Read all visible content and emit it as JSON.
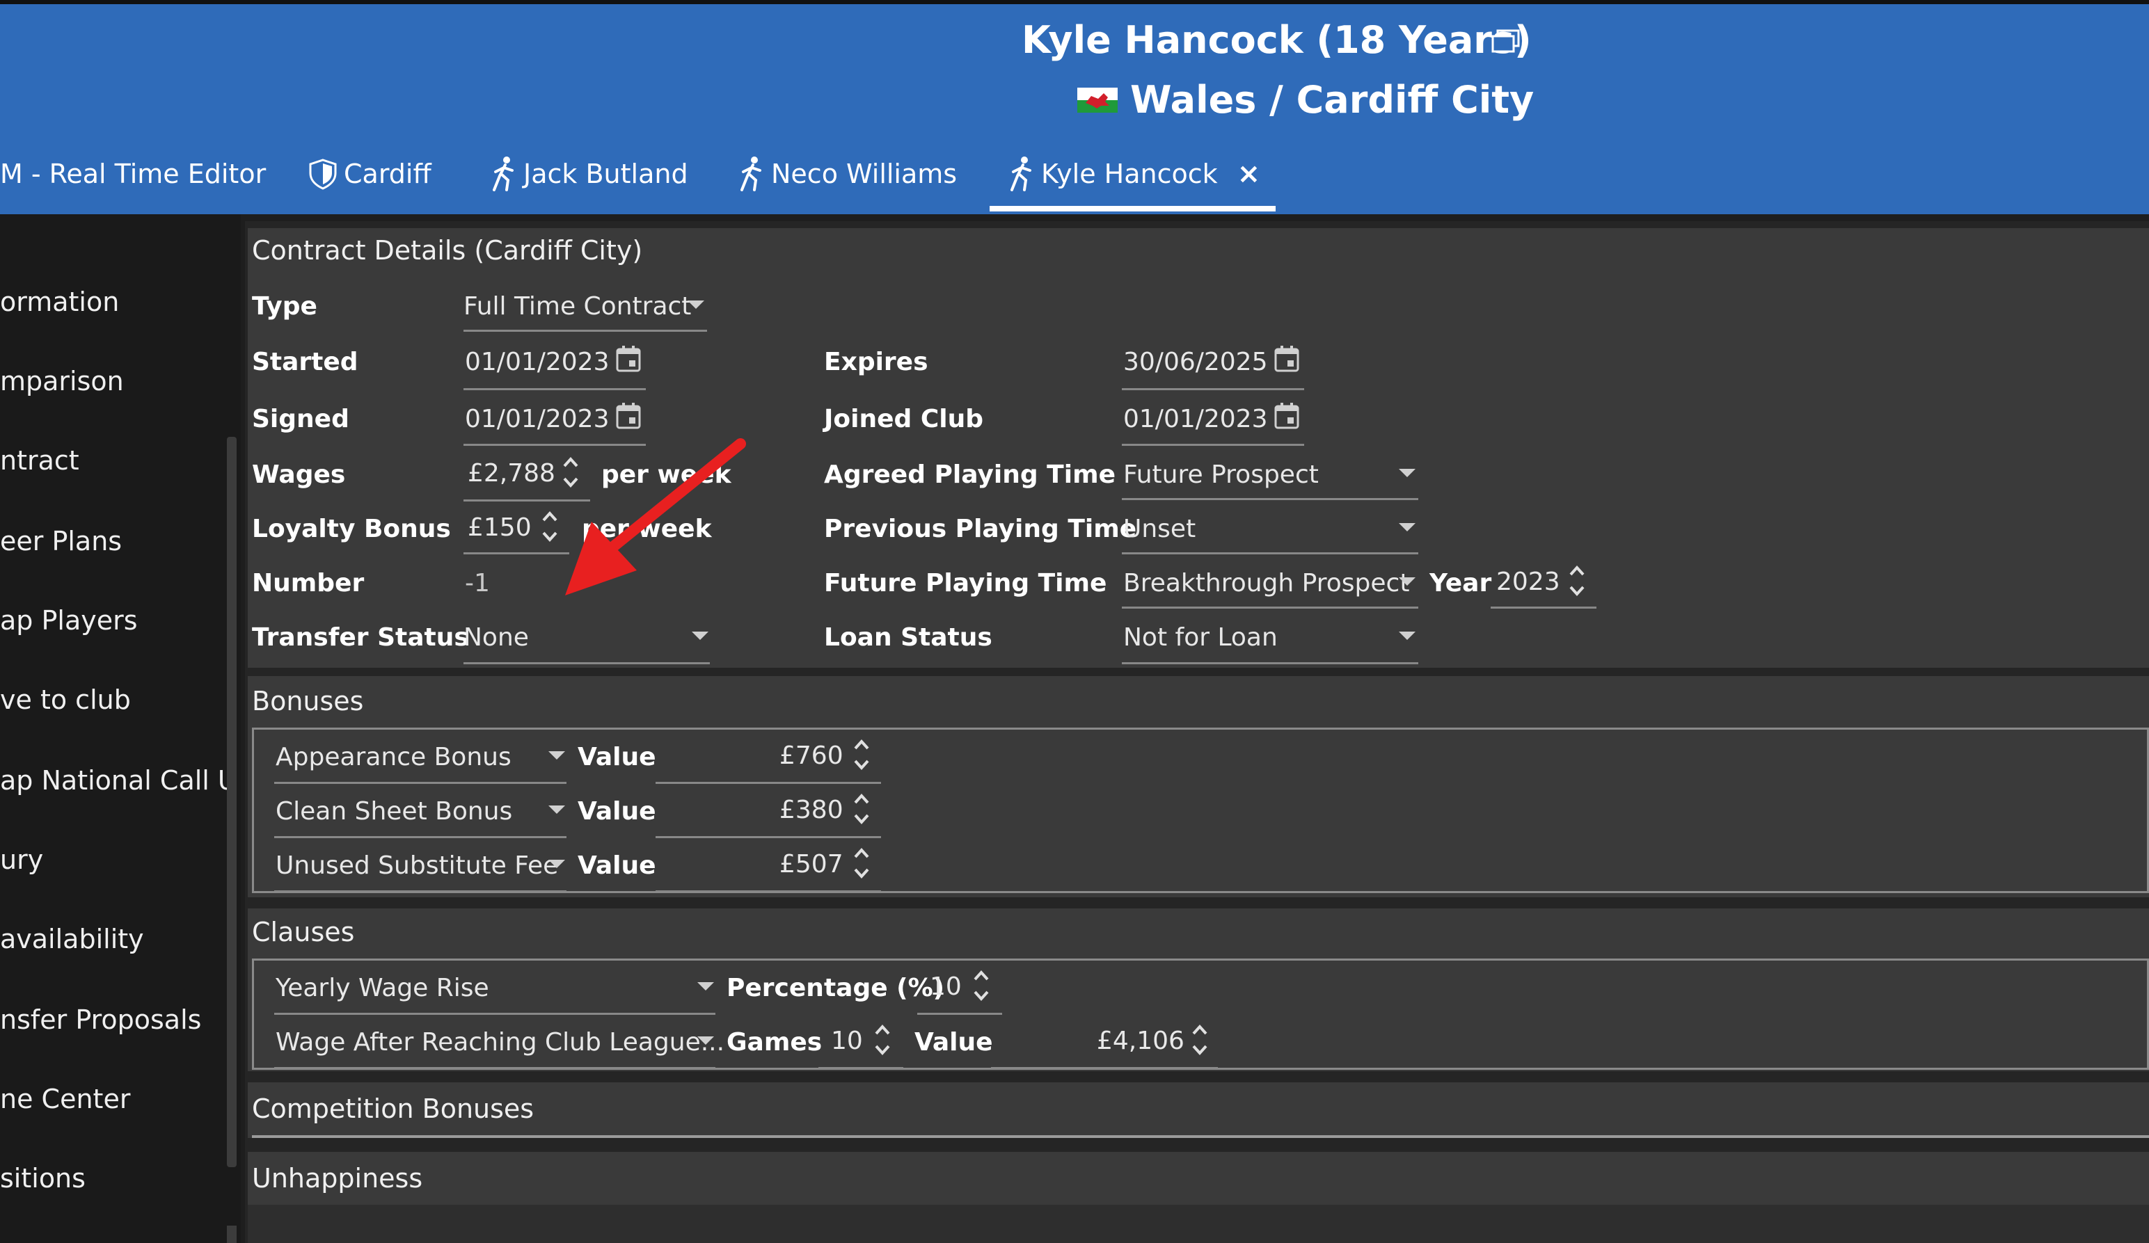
{
  "header": {
    "title": "Kyle Hancock (18 Years)",
    "subtitle": "Wales / Cardiff City",
    "colors": {
      "bar": "#2f6bb9",
      "text": "#ffffff"
    }
  },
  "tabs": [
    {
      "label": "M - Real Time Editor",
      "icon": "none"
    },
    {
      "label": "Cardiff",
      "icon": "shield-icon"
    },
    {
      "label": "Jack Butland",
      "icon": "running-player-icon"
    },
    {
      "label": "Neco Williams",
      "icon": "running-player-icon"
    },
    {
      "label": "Kyle Hancock",
      "icon": "running-player-icon",
      "active": true,
      "close": "×"
    }
  ],
  "sidebar": {
    "items": [
      "ormation",
      "mparison",
      "ntract",
      "eer Plans",
      "ap Players",
      "ve to club",
      "ap National Call Up",
      "ury",
      "availability",
      "nsfer Proposals",
      "ne Center",
      "sitions"
    ]
  },
  "contract": {
    "title": "Contract Details (Cardiff City)",
    "type_label": "Type",
    "type_value": "Full Time Contract",
    "started_label": "Started",
    "started_value": "01/01/2023",
    "signed_label": "Signed",
    "signed_value": "01/01/2023",
    "wages_label": "Wages",
    "wages_value": "£2,788",
    "wages_unit": "per week",
    "loyalty_label": "Loyalty Bonus",
    "loyalty_value": "£150",
    "loyalty_unit": "per week",
    "number_label": "Number",
    "number_value": "-1",
    "transfer_label": "Transfer Status",
    "transfer_value": "None",
    "expires_label": "Expires",
    "expires_value": "30/06/2025",
    "joined_label": "Joined Club",
    "joined_value": "01/01/2023",
    "agreed_label": "Agreed Playing Time",
    "agreed_value": "Future Prospect",
    "previous_label": "Previous Playing Time",
    "previous_value": "Unset",
    "future_label": "Future Playing Time",
    "future_value": "Breakthrough Prospect",
    "year_label": "Year",
    "year_value": "2023",
    "loan_label": "Loan Status",
    "loan_value": "Not for Loan"
  },
  "bonuses": {
    "title": "Bonuses",
    "value_label": "Value",
    "rows": [
      {
        "type": "Appearance Bonus",
        "value": "£760"
      },
      {
        "type": "Clean Sheet Bonus",
        "value": "£380"
      },
      {
        "type": "Unused Substitute Fee",
        "value": "£507"
      }
    ]
  },
  "clauses": {
    "title": "Clauses",
    "row1": {
      "type": "Yearly Wage Rise",
      "pct_label": "Percentage (%)",
      "pct_value": "10"
    },
    "row2": {
      "type": "Wage After Reaching Club League...",
      "games_label": "Games",
      "games_value": "10",
      "value_label": "Value",
      "value": "£4,106"
    }
  },
  "competition_bonuses": {
    "title": "Competition Bonuses"
  },
  "unhappiness": {
    "title": "Unhappiness"
  },
  "annotation": {
    "color": "#e82020"
  }
}
